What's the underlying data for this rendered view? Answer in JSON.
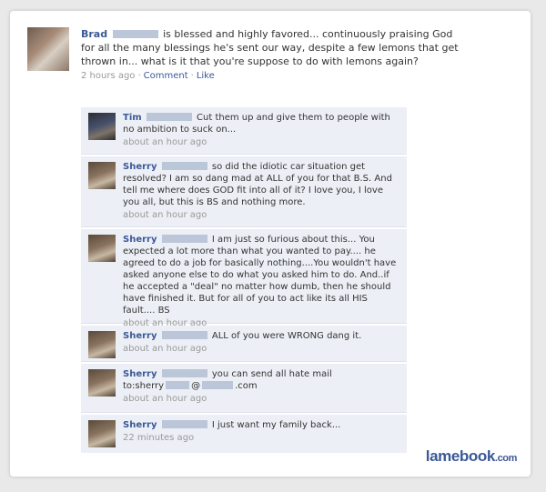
{
  "post": {
    "author": "Brad",
    "text": "is blessed and highly favored... continuously praising God for all the many blessings he's sent our way, despite a few lemons that get thrown in... what is it that you're suppose to do with lemons again?",
    "time": "2 hours ago",
    "comment_label": "Comment",
    "like_label": "Like"
  },
  "comments": [
    {
      "author": "Tim",
      "text": "Cut them up and give them to people with no ambition to suck on...",
      "time": "about an hour ago"
    },
    {
      "author": "Sherry",
      "text": "so did the idiotic car situation get resolved? I am so dang mad at ALL of you for that B.S. And tell me where does GOD fit into all of it? I love you, I love you all, but this is BS and nothing more.",
      "time": "about an hour ago"
    },
    {
      "author": "Sherry",
      "text": "I am just so furious about this... You expected a lot more than what you wanted to pay.... he agreed to do a job for basically nothing....You wouldn't have asked anyone else to do what you asked him to do. And..if he accepted a \"deal\" no matter how dumb, then he should have finished it. But for all of you to act like its all HIS fault.... BS",
      "time": "about an hour ago"
    },
    {
      "author": "Sherry",
      "text": "ALL of you were WRONG dang it.",
      "time": "about an hour ago"
    },
    {
      "author": "Sherry",
      "text": "you can send all hate mail",
      "text2a": "to:sherry",
      "text2b": "@",
      "text2c": ".com",
      "time": "about an hour ago"
    },
    {
      "author": "Sherry",
      "text": "I just want my family back...",
      "time": "22 minutes ago"
    }
  ],
  "watermark": {
    "name": "lamebook",
    "tld": ".com"
  }
}
